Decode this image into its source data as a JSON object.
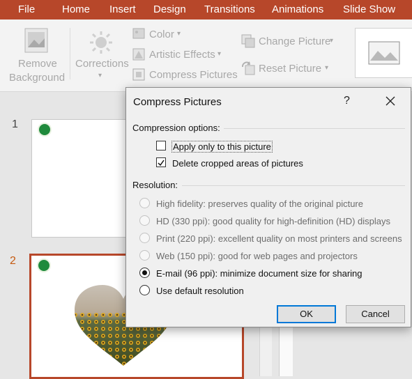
{
  "tabs": [
    "File",
    "Home",
    "Insert",
    "Design",
    "Transitions",
    "Animations",
    "Slide Show"
  ],
  "ribbon": {
    "remove_bg_line1": "Remove",
    "remove_bg_line2": "Background",
    "corrections": "Corrections",
    "color": "Color",
    "artistic_effects": "Artistic Effects",
    "compress_pictures": "Compress Pictures",
    "change_picture": "Change Picture",
    "reset_picture": "Reset Picture"
  },
  "slides": [
    {
      "number": "1"
    },
    {
      "number": "2"
    }
  ],
  "dialog": {
    "title": "Compress Pictures",
    "help": "?",
    "compression_title": "Compression options:",
    "apply_only": {
      "label": "Apply only to this picture",
      "checked": false
    },
    "delete_cropped": {
      "label": "Delete cropped areas of pictures",
      "checked": true
    },
    "resolution_title": "Resolution:",
    "options": [
      {
        "label": "High fidelity: preserves quality of the original picture",
        "enabled": false,
        "selected": false
      },
      {
        "label": "HD (330 ppi): good quality for high-definition (HD) displays",
        "enabled": false,
        "selected": false
      },
      {
        "label": "Print (220 ppi): excellent quality on most printers and screens",
        "enabled": false,
        "selected": false
      },
      {
        "label": "Web (150 ppi): good for web pages and projectors",
        "enabled": false,
        "selected": false
      },
      {
        "label": "E-mail (96 ppi): minimize document size for sharing",
        "enabled": true,
        "selected": true
      },
      {
        "label": "Use default resolution",
        "enabled": true,
        "selected": false
      }
    ],
    "ok": "OK",
    "cancel": "Cancel"
  },
  "colors": {
    "accent": "#b7472a",
    "button_focus": "#0078d7"
  }
}
